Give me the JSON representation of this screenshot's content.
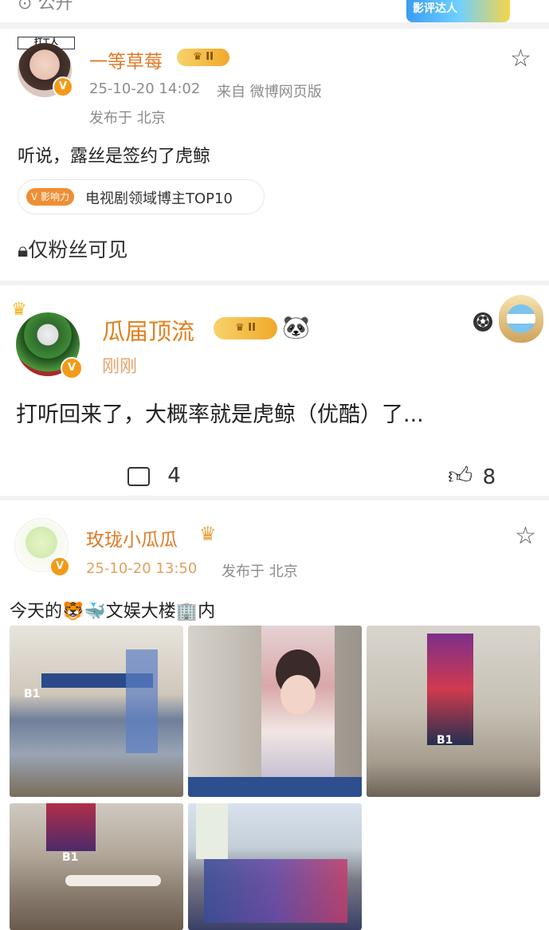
{
  "top": {
    "open_label": "公开",
    "badge_label": "影评达人"
  },
  "post1": {
    "avatar_caption": "打工人",
    "username": "一等草莓",
    "level": "II",
    "timestamp": "25-10-20 14:02",
    "source": "来自 微博网页版",
    "location": "发布于 北京",
    "content": "听说，露丝是签约了虎鲸",
    "influence_tag": "影响力",
    "influence_text": "电视剧领域博主TOP10",
    "visibility": "仅粉丝可见"
  },
  "comment": {
    "username": "瓜届顶流",
    "level": "II",
    "panda": "🐼",
    "time": "刚刚",
    "content": "打听回来了，大概率就是虎鲸（优酷）了...",
    "comment_count": "4",
    "like_count": "8"
  },
  "post2": {
    "username": "玫珑小瓜瓜",
    "timestamp": "25-10-20 13:50",
    "location": "发布于 北京",
    "content": "今天的🐯🐳文娱大楼🏢内",
    "photos": [
      {
        "label": "B1"
      },
      {
        "label": ""
      },
      {
        "label": "B1"
      },
      {
        "label": "B1"
      },
      {
        "label": ""
      }
    ]
  }
}
